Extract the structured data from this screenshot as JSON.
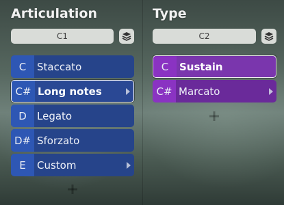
{
  "articulation": {
    "title": "Articulation",
    "selector_value": "C1",
    "items": [
      {
        "key": "C",
        "label": "Staccato",
        "has_submenu": false,
        "selected": false
      },
      {
        "key": "C#",
        "label": "Long notes",
        "has_submenu": true,
        "selected": true
      },
      {
        "key": "D",
        "label": "Legato",
        "has_submenu": false,
        "selected": false
      },
      {
        "key": "D#",
        "label": "Sforzato",
        "has_submenu": false,
        "selected": false
      },
      {
        "key": "E",
        "label": "Custom",
        "has_submenu": true,
        "selected": false
      }
    ],
    "add_symbol": "+"
  },
  "type": {
    "title": "Type",
    "selector_value": "C2",
    "items": [
      {
        "key": "C",
        "label": "Sustain",
        "has_submenu": false,
        "selected": true
      },
      {
        "key": "C#",
        "label": "Marcato",
        "has_submenu": true,
        "selected": false
      }
    ],
    "add_symbol": "+"
  },
  "icons": {
    "layers": "layers-icon",
    "add": "plus-icon",
    "submenu": "chevron-right-icon"
  },
  "colors": {
    "articulation_accent": "#2e57b4",
    "type_accent": "#8a33c2"
  }
}
